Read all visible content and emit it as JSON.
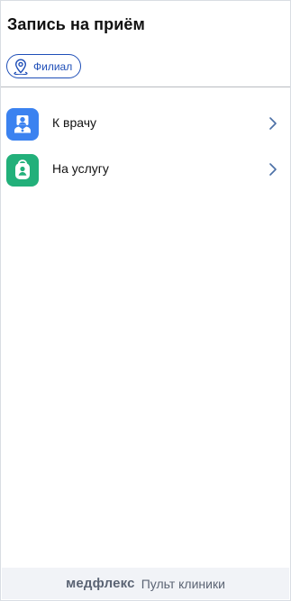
{
  "header": {
    "title": "Запись на приём"
  },
  "filter_chip": {
    "label": "Филиал",
    "icon": "location-pin-icon"
  },
  "menu": {
    "items": [
      {
        "label": "К врачу",
        "icon": "doctor-icon",
        "icon_color": "#3b82f0"
      },
      {
        "label": "На услугу",
        "icon": "service-icon",
        "icon_color": "#22b07a"
      }
    ]
  },
  "footer": {
    "brand": "медфлекс",
    "subtitle": "Пульт клиники"
  },
  "colors": {
    "accent": "#1f4fb8",
    "chevron": "#4a6fa5"
  }
}
